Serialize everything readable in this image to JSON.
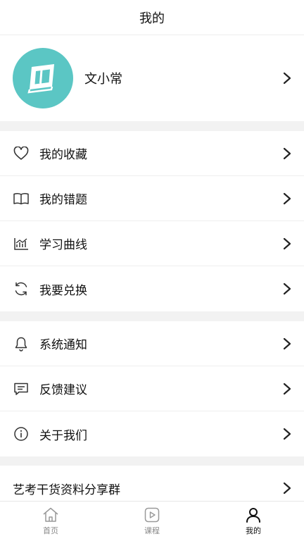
{
  "header": {
    "title": "我的"
  },
  "profile": {
    "name": "文小常"
  },
  "groups": [
    {
      "items": [
        {
          "label": "我的收藏",
          "icon": "heart-icon"
        },
        {
          "label": "我的错题",
          "icon": "book-icon"
        },
        {
          "label": "学习曲线",
          "icon": "chart-icon"
        },
        {
          "label": "我要兑换",
          "icon": "refresh-icon"
        }
      ]
    },
    {
      "items": [
        {
          "label": "系统通知",
          "icon": "bell-icon"
        },
        {
          "label": "反馈建议",
          "icon": "message-icon"
        },
        {
          "label": "关于我们",
          "icon": "info-icon"
        }
      ]
    },
    {
      "items": [
        {
          "label": "艺考干货资料分享群"
        }
      ]
    }
  ],
  "tabbar": {
    "tabs": [
      {
        "label": "首页",
        "icon": "home-icon",
        "active": false
      },
      {
        "label": "课程",
        "icon": "play-icon",
        "active": false
      },
      {
        "label": "我的",
        "icon": "user-icon",
        "active": true
      }
    ]
  },
  "colors": {
    "accent": "#5bc6c4",
    "background": "#f2f2f2"
  }
}
